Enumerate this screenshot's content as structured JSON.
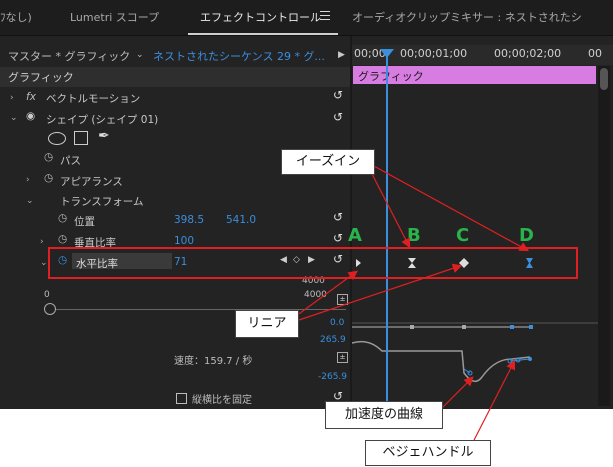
{
  "tabs": [
    {
      "label": "ﾌなし)"
    },
    {
      "label": "Lumetri スコープ"
    },
    {
      "label": "エフェクトコントロール"
    },
    {
      "label": "オーディオクリップミキサー : ネストされたシ"
    }
  ],
  "source": {
    "master_label": "マスター * グラフィック",
    "sequence_label": "ネストされたシーケンス 29 * グ..."
  },
  "ruler": {
    "t0": "00;00",
    "t1": "00;00;01;00",
    "t2": "00;00;02;00",
    "t3": "00"
  },
  "clip": {
    "label": "グラフィック"
  },
  "section": {
    "label": "グラフィック"
  },
  "rows": {
    "vector_motion": "ベクトルモーション",
    "fx": "fx",
    "shape": "シェイプ (シェイプ 01)",
    "path": "パス",
    "appearance": "アピアランス",
    "transform": "トランスフォーム",
    "position_label": "位置",
    "position_x": "398.5",
    "position_y": "541.0",
    "vscale_label": "垂直比率",
    "vscale_value": "100",
    "hscale_label": "水平比率",
    "hscale_value": "71",
    "graph_min": "0",
    "graph_max_top": "4000",
    "graph_max": "4000",
    "graph_zero": "0.0",
    "vel_top": "265.9",
    "vel_bottom": "-265.9",
    "speed": "速度：159.7 / 秒",
    "lock_ratio": "縦横比を固定"
  },
  "annotations": {
    "ease_in": "イーズイン",
    "linear": "リニア",
    "accel_curve": "加速度の曲線",
    "bezier_handle": "ベジェハンドル",
    "A": "A",
    "B": "B",
    "C": "C",
    "D": "D"
  },
  "colors": {
    "accent": "#3a8fde",
    "clip": "#d77ce0",
    "callout_line": "#e02020",
    "letters": "#29b34a"
  }
}
